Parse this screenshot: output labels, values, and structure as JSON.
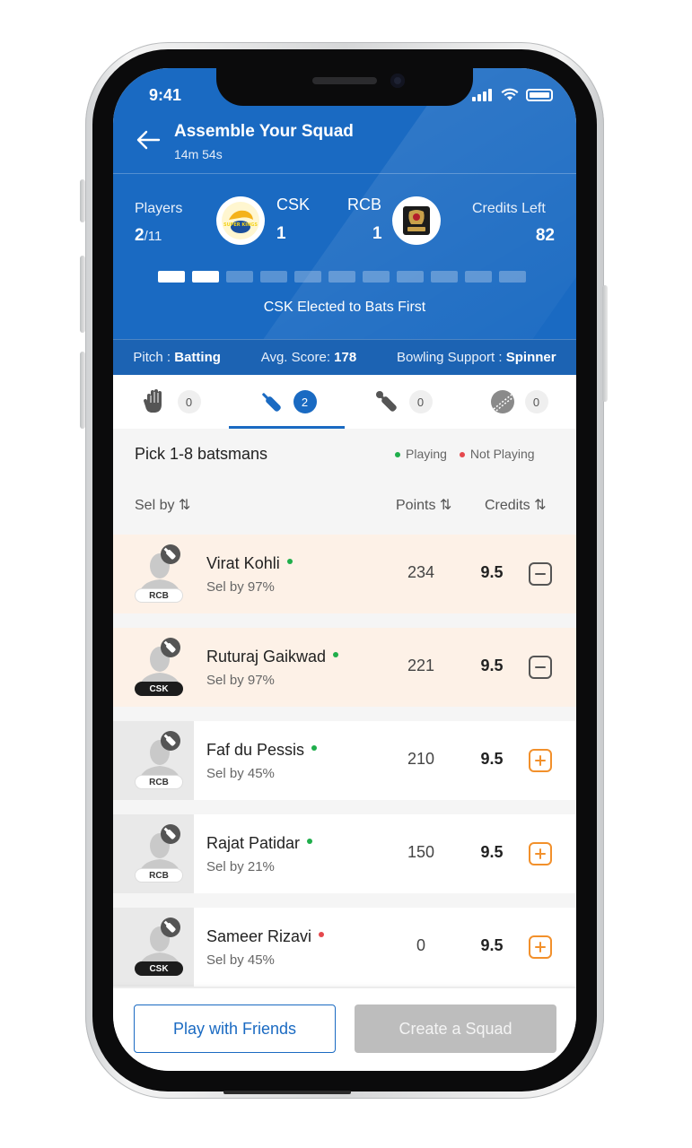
{
  "status": {
    "time": "9:41"
  },
  "header": {
    "title": "Assemble Your Squad",
    "timer": "14m 54s",
    "players_label": "Players",
    "players_count": "2",
    "players_total": "/11",
    "team1": {
      "name": "CSK",
      "score": "1",
      "logo_text": "SUPER KINGS"
    },
    "team2": {
      "name": "RCB",
      "score": "1"
    },
    "credits_label": "Credits Left",
    "credits_value": "82",
    "progress": {
      "filled": 2,
      "total": 11
    },
    "elected_text": "CSK Elected to Bats First"
  },
  "pitch": {
    "pitch_label": "Pitch :",
    "pitch_value": "Batting",
    "avg_label": "Avg. Score:",
    "avg_value": "178",
    "bowling_label": "Bowling Support :",
    "bowling_value": "Spinner"
  },
  "tabs": [
    {
      "icon": "wicket-keeper-gloves-icon",
      "count": "0",
      "active": false
    },
    {
      "icon": "bat-icon",
      "count": "2",
      "active": true
    },
    {
      "icon": "bat-ball-icon",
      "count": "0",
      "active": false
    },
    {
      "icon": "cricket-ball-icon",
      "count": "0",
      "active": false
    }
  ],
  "list": {
    "pick_text": "Pick 1-8 batsmans",
    "legend_playing": "Playing",
    "legend_not_playing": "Not Playing",
    "col_sel": "Sel by",
    "col_points": "Points",
    "col_credits": "Credits",
    "players": [
      {
        "name": "Virat Kohli",
        "sel": "Sel by 97%",
        "points": "234",
        "credits": "9.5",
        "team": "RCB",
        "playing": true,
        "selected": true
      },
      {
        "name": "Ruturaj Gaikwad",
        "sel": "Sel by 97%",
        "points": "221",
        "credits": "9.5",
        "team": "CSK",
        "playing": true,
        "selected": true
      },
      {
        "name": "Faf du Pessis",
        "sel": "Sel by 45%",
        "points": "210",
        "credits": "9.5",
        "team": "RCB",
        "playing": true,
        "selected": false
      },
      {
        "name": "Rajat Patidar",
        "sel": "Sel by 21%",
        "points": "150",
        "credits": "9.5",
        "team": "RCB",
        "playing": true,
        "selected": false
      },
      {
        "name": "Sameer Rizavi",
        "sel": "Sel by 45%",
        "points": "0",
        "credits": "9.5",
        "team": "CSK",
        "playing": false,
        "selected": false
      }
    ]
  },
  "actions": {
    "play_friends": "Play with Friends",
    "create_squad": "Create a Squad"
  },
  "colors": {
    "brand_blue": "#1a6ac2",
    "playing_green": "#1fae4b",
    "not_playing_red": "#e5484d",
    "add_orange": "#f2902b",
    "selected_row_bg": "#fdf1e7"
  }
}
